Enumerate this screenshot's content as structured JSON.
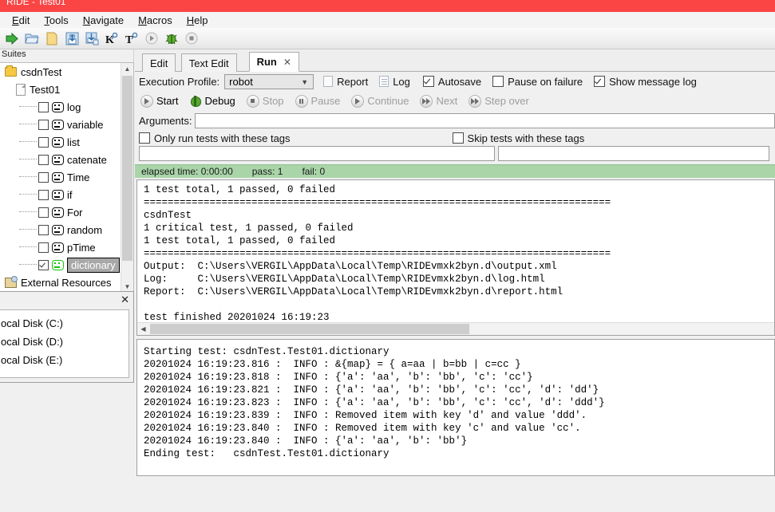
{
  "window": {
    "title": "RIDE - Test01",
    "title_color": "#fb4545"
  },
  "menubar": {
    "items": [
      {
        "name": "edit",
        "mnemonic": "E",
        "rest": "dit"
      },
      {
        "name": "tools",
        "mnemonic": "T",
        "rest": "ools"
      },
      {
        "name": "navigate",
        "mnemonic": "N",
        "rest": "avigate"
      },
      {
        "name": "macros",
        "mnemonic": "M",
        "rest": "acros"
      },
      {
        "name": "help",
        "mnemonic": "H",
        "rest": "elp"
      }
    ]
  },
  "toolbar": {
    "buttons": [
      {
        "icon": "run-arrow-icon",
        "enabled": true
      },
      {
        "icon": "open-folder-icon",
        "enabled": true
      },
      {
        "icon": "new-file-icon",
        "enabled": true
      },
      {
        "icon": "save-icon",
        "enabled": true
      },
      {
        "icon": "save-all-icon",
        "enabled": true
      },
      {
        "icon": "search-keyword-icon",
        "label": "K",
        "enabled": true
      },
      {
        "icon": "search-tests-icon",
        "label": "T",
        "enabled": true
      },
      {
        "icon": "play-circle-icon",
        "enabled": false
      },
      {
        "icon": "debug-bug-icon",
        "enabled": true
      },
      {
        "icon": "stop-circle-icon",
        "enabled": false
      }
    ]
  },
  "sidebar": {
    "header": "Suites",
    "tree": [
      {
        "label": "csdnTest",
        "icon": "folder-icon",
        "level": 1,
        "checkbox": false
      },
      {
        "label": "Test01",
        "icon": "file-icon",
        "level": 2,
        "checkbox": false
      },
      {
        "label": "log",
        "icon": "robot-icon",
        "level": 3,
        "checkbox": true,
        "checked": false,
        "passed": false
      },
      {
        "label": "variable",
        "icon": "robot-icon",
        "level": 3,
        "checkbox": true,
        "checked": false,
        "passed": false
      },
      {
        "label": "list",
        "icon": "robot-icon",
        "level": 3,
        "checkbox": true,
        "checked": false,
        "passed": false
      },
      {
        "label": "catenate",
        "icon": "robot-icon",
        "level": 3,
        "checkbox": true,
        "checked": false,
        "passed": false
      },
      {
        "label": "Time",
        "icon": "robot-icon",
        "level": 3,
        "checkbox": true,
        "checked": false,
        "passed": false
      },
      {
        "label": "if",
        "icon": "robot-icon",
        "level": 3,
        "checkbox": true,
        "checked": false,
        "passed": false
      },
      {
        "label": "For",
        "icon": "robot-icon",
        "level": 3,
        "checkbox": true,
        "checked": false,
        "passed": false
      },
      {
        "label": "random",
        "icon": "robot-icon",
        "level": 3,
        "checkbox": true,
        "checked": false,
        "passed": false
      },
      {
        "label": "pTime",
        "icon": "robot-icon",
        "level": 3,
        "checkbox": true,
        "checked": false,
        "passed": false
      },
      {
        "label": "dictionary",
        "icon": "robot-icon",
        "level": 3,
        "checkbox": true,
        "checked": true,
        "passed": true,
        "selected": true
      },
      {
        "label": "External Resources",
        "icon": "resource-icon",
        "level": 1,
        "checkbox": false
      }
    ]
  },
  "file_popup": {
    "close_label": "✕",
    "items": [
      "ocal Disk (C:)",
      "ocal Disk (D:)",
      "ocal Disk (E:)"
    ]
  },
  "tabs": [
    {
      "label": "Edit",
      "active": false
    },
    {
      "label": "Text Edit",
      "active": false
    },
    {
      "label": "Run",
      "active": true,
      "close": "✕"
    }
  ],
  "run_panel": {
    "profile_label": "Execution Profile:",
    "profile_value": "robot",
    "report_label": "Report",
    "log_label": "Log",
    "autosave_label": "Autosave",
    "autosave_checked": true,
    "pause_on_failure_label": "Pause on failure",
    "pause_on_failure_checked": false,
    "show_message_log_label": "Show message log",
    "show_message_log_checked": true,
    "buttons": [
      {
        "label": "Start",
        "icon": "play-circle-icon",
        "enabled": true
      },
      {
        "label": "Debug",
        "icon": "debug-bug-icon",
        "enabled": true
      },
      {
        "label": "Stop",
        "icon": "stop-circle-icon",
        "enabled": false
      },
      {
        "label": "Pause",
        "icon": "pause-circle-icon",
        "enabled": false
      },
      {
        "label": "Continue",
        "icon": "play-circle-icon",
        "enabled": false
      },
      {
        "label": "Next",
        "icon": "next-circle-icon",
        "enabled": false
      },
      {
        "label": "Step over",
        "icon": "step-over-circle-icon",
        "enabled": false
      }
    ],
    "arguments_label": "Arguments:",
    "arguments_value": "",
    "only_run_tags_label": "Only run tests with these tags",
    "only_run_tags_checked": false,
    "only_run_tags_value": "",
    "skip_tags_label": "Skip tests with these tags",
    "skip_tags_checked": false,
    "skip_tags_value": ""
  },
  "status": {
    "elapsed": "elapsed time: 0:00:00",
    "pass": "pass: 1",
    "fail": "fail: 0",
    "color": "#a9d5a9"
  },
  "console_output": "1 test total, 1 passed, 0 failed\n==============================================================================\ncsdnTest\n1 critical test, 1 passed, 0 failed\n1 test total, 1 passed, 0 failed\n==============================================================================\nOutput:  C:\\Users\\VERGIL\\AppData\\Local\\Temp\\RIDEvmxk2byn.d\\output.xml\nLog:     C:\\Users\\VERGIL\\AppData\\Local\\Temp\\RIDEvmxk2byn.d\\log.html\nReport:  C:\\Users\\VERGIL\\AppData\\Local\\Temp\\RIDEvmxk2byn.d\\report.html\n\ntest finished 20201024 16:19:23",
  "message_log": "Starting test: csdnTest.Test01.dictionary\n20201024 16:19:23.816 :  INFO : &{map} = { a=aa | b=bb | c=cc }\n20201024 16:19:23.818 :  INFO : {'a': 'aa', 'b': 'bb', 'c': 'cc'}\n20201024 16:19:23.821 :  INFO : {'a': 'aa', 'b': 'bb', 'c': 'cc', 'd': 'dd'}\n20201024 16:19:23.823 :  INFO : {'a': 'aa', 'b': 'bb', 'c': 'cc', 'd': 'ddd'}\n20201024 16:19:23.839 :  INFO : Removed item with key 'd' and value 'ddd'.\n20201024 16:19:23.840 :  INFO : Removed item with key 'c' and value 'cc'.\n20201024 16:19:23.840 :  INFO : {'a': 'aa', 'b': 'bb'}\nEnding test:   csdnTest.Test01.dictionary"
}
